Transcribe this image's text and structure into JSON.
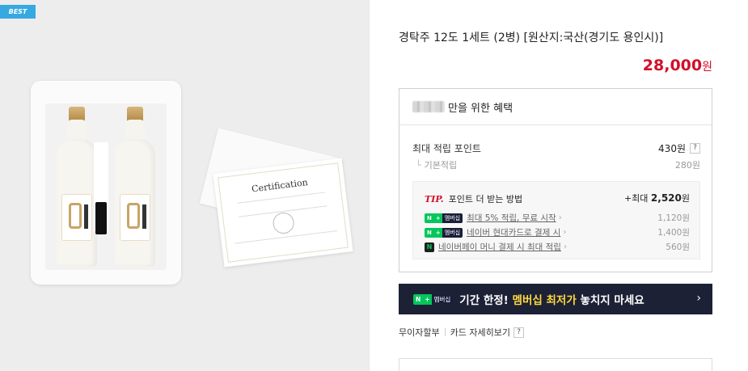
{
  "image": {
    "badge": "BEST",
    "certificate_title": "Certification"
  },
  "product": {
    "title": "경탁주 12도 1세트 (2병) [원산지:국산(경기도 용인시)]",
    "price": "28,000",
    "price_unit": "원"
  },
  "benefits": {
    "header_suffix": "만을 위한 혜택",
    "max_points_label": "최대 적립 포인트",
    "max_points_value": "430원",
    "base_label": "기본적립",
    "base_value": "280원",
    "help_icon": "?",
    "tip": {
      "label": "TIP.",
      "text": "포인트 더 받는 방법",
      "max_prefix": "+최대",
      "max_value": "2,520",
      "max_unit": "원",
      "items": [
        {
          "badge": "membership",
          "text": "최대 5% 적립, 무료 시작",
          "amount": "1,120원"
        },
        {
          "badge": "membership",
          "text": "네이버 현대카드로 결제 시",
          "amount": "1,400원"
        },
        {
          "badge": "npay",
          "text": "네이버페이 머니 결제 시 최대 적립",
          "amount": "560원"
        }
      ]
    }
  },
  "badges": {
    "n": "N",
    "plus": "+",
    "membership": "멤버십",
    "npay": "N"
  },
  "banner": {
    "text_before": "기간 한정! ",
    "highlight": "멤버십 최저가",
    "text_after": " 놓치지 마세요",
    "chevron": "›"
  },
  "links": {
    "installment": "무이자할부",
    "card_detail": "카드 자세히보기",
    "help": "?"
  },
  "colors": {
    "price_red": "#d10f2a",
    "naver_green": "#03c75a",
    "banner_navy": "#1c2136",
    "banner_highlight": "#ffd93d",
    "best_badge_blue": "#36a9e1"
  }
}
